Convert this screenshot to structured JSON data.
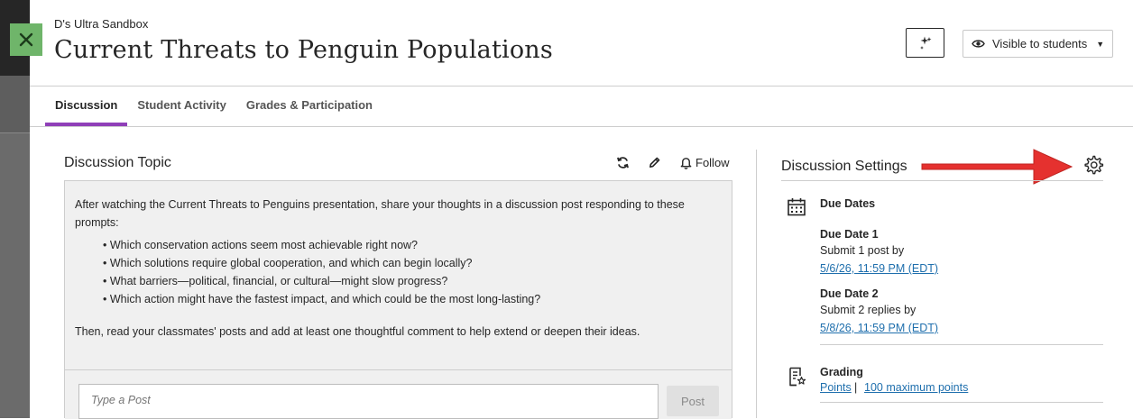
{
  "header": {
    "course_name": "D's Ultra Sandbox",
    "title": "Current Threats to Penguin Populations",
    "visibility_label": "Visible to students"
  },
  "tabs": [
    {
      "label": "Discussion",
      "active": true
    },
    {
      "label": "Student Activity",
      "active": false
    },
    {
      "label": "Grades & Participation",
      "active": false
    }
  ],
  "topic": {
    "heading": "Discussion Topic",
    "follow_label": "Follow",
    "intro": "After watching the Current Threats to Penguins presentation, share your thoughts in a discussion post responding to these prompts:",
    "prompts": [
      "Which conservation actions seem most achievable right now?",
      "Which solutions require global cooperation, and which can begin locally?",
      "What barriers—political, financial, or cultural—might slow progress?",
      "Which action might have the fastest impact, and which could be the most long-lasting?"
    ],
    "outro": "Then, read your classmates' posts and add at least one thoughtful comment to help extend or deepen their ideas.",
    "post_placeholder": "Type a Post",
    "post_button": "Post"
  },
  "settings": {
    "heading": "Discussion Settings",
    "due_dates_label": "Due Dates",
    "due_date_1": {
      "label": "Due Date 1",
      "requirement": "Submit 1 post by",
      "date": "5/6/26, 11:59 PM (EDT)"
    },
    "due_date_2": {
      "label": "Due Date 2",
      "requirement": "Submit 2 replies by",
      "date": "5/8/26, 11:59 PM (EDT)"
    },
    "grading_label": "Grading",
    "grading_scheme": "Points",
    "max_points": "100 maximum points"
  },
  "colors": {
    "accent": "#8f3fb8",
    "link": "#1f6fad",
    "close_button": "#6fb56a",
    "annotation_arrow": "#e5312f"
  },
  "icons": [
    "close-icon",
    "ai-sparkle-icon",
    "eye-icon",
    "chevron-down-icon",
    "refresh-icon",
    "pencil-icon",
    "bell-icon",
    "gear-icon",
    "calendar-icon",
    "grading-icon"
  ]
}
